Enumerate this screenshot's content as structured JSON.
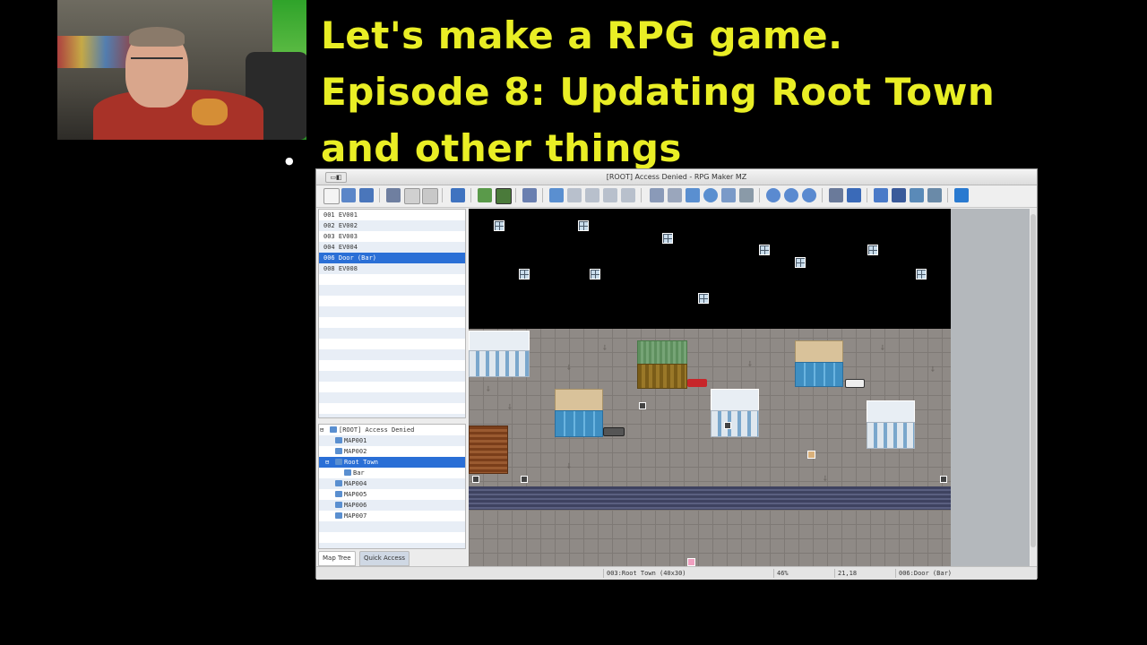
{
  "title_lines": [
    "Let's make a RPG game.",
    "Episode 8: Updating Root Town",
    "and other things"
  ],
  "window": {
    "title": "[ROOT] Access Denied - RPG Maker MZ",
    "title_button": "▭◧"
  },
  "events": [
    {
      "label": "001 EV001"
    },
    {
      "label": "002 EV002"
    },
    {
      "label": "003 EV003"
    },
    {
      "label": "004 EV004"
    },
    {
      "label": "006 Door (Bar)"
    },
    {
      "label": "008 EV008"
    }
  ],
  "map_tree": [
    {
      "label": "[ROOT] Access Denied"
    },
    {
      "label": "MAP001"
    },
    {
      "label": "MAP002"
    },
    {
      "label": "Root Town"
    },
    {
      "label": "Bar"
    },
    {
      "label": "MAP004"
    },
    {
      "label": "MAP005"
    },
    {
      "label": "MAP006"
    },
    {
      "label": "MAP007"
    }
  ],
  "tabs": {
    "map_tree": "Map Tree",
    "quick_access": "Quick Access"
  },
  "status": {
    "map": "003:Root Town (40x30)",
    "zoom": "46%",
    "coords": "21,18",
    "event": "006:Door (Bar)"
  },
  "colors": {
    "title_text": "#e9ee25",
    "selection": "#2a6fd6",
    "background": "#000000"
  }
}
